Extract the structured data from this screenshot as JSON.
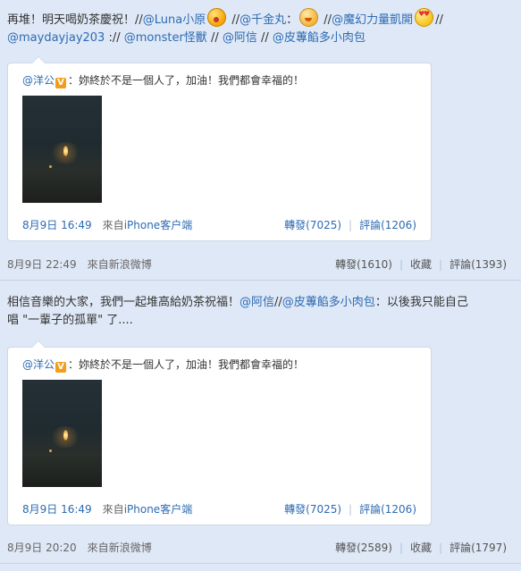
{
  "posts": [
    {
      "text_parts": [
        "再堆！明天喝奶茶慶祝！//",
        "@Luna小原",
        "",
        " //",
        "@千金丸",
        "：",
        "",
        " //",
        "@魔幻力量凱開",
        "",
        "//",
        "@maydayjay203",
        " :// ",
        "@monster怪獸",
        " // ",
        "@阿信",
        " // ",
        "@皮蓴餡多小肉包"
      ],
      "emojis": [
        "laughing-face-emoji",
        "shy-face-emoji",
        "heart-eyes-emoji"
      ],
      "quote": {
        "author": "@洋公",
        "badge": "V",
        "text": "：妳終於不是一個人了，加油！我們都會幸福的！",
        "date": "8月9日 16:49",
        "source_prefix": "來自",
        "source": "iPhone客户端",
        "repost": "轉發(7025)",
        "comment": "評論(1206)"
      },
      "date": "8月9日 22:49",
      "source_prefix": "來自",
      "source": "新浪微博",
      "repost": "轉發(1610)",
      "favorite": "收藏",
      "comment": "評論(1393)"
    },
    {
      "line1_parts": [
        "相信音樂的大家，我們一起堆高給奶茶祝福！",
        "@阿信",
        "//",
        "@皮蓴餡多小肉包",
        "：以後我只能自己"
      ],
      "line2": "唱 \"一輩子的孤單\" 了....",
      "quote": {
        "author": "@洋公",
        "badge": "V",
        "text": "：妳終於不是一個人了，加油！我們都會幸福的！",
        "date": "8月9日 16:49",
        "source_prefix": "來自",
        "source": "iPhone客户端",
        "repost": "轉發(7025)",
        "comment": "評論(1206)"
      },
      "date": "8月9日 20:20",
      "source_prefix": "來自",
      "source": "新浪微博",
      "repost": "轉發(2589)",
      "favorite": "收藏",
      "comment": "評論(1797)"
    }
  ],
  "separator": "|",
  "colors": {
    "link": "#2d6bb3",
    "background": "#dfe8f6",
    "card": "#ffffff",
    "badge": "#f49c1b"
  }
}
